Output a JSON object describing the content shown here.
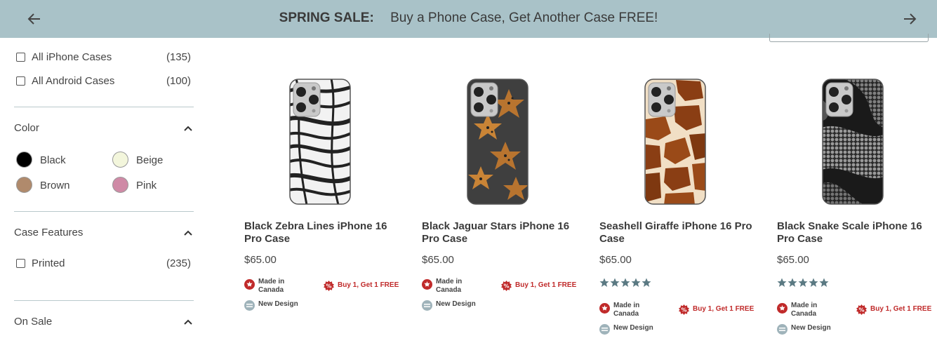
{
  "banner": {
    "strong": "SPRING SALE:",
    "message": "Buy a Phone Case, Get Another Case FREE!"
  },
  "filters": {
    "categories": [
      {
        "label": "All iPhone Cases",
        "count": "(135)"
      },
      {
        "label": "All Android Cases",
        "count": "(100)"
      }
    ],
    "color": {
      "title": "Color",
      "options": [
        {
          "label": "Black",
          "swatch": "#000000"
        },
        {
          "label": "Beige",
          "swatch": "#f3f6dc"
        },
        {
          "label": "Brown",
          "swatch": "#b08a6c"
        },
        {
          "label": "Pink",
          "swatch": "#cf8aa6"
        }
      ]
    },
    "case_features": {
      "title": "Case Features",
      "options": [
        {
          "label": "Printed",
          "count": "(235)"
        }
      ]
    },
    "on_sale": {
      "title": "On Sale"
    }
  },
  "products": [
    {
      "title_line1": "Black Zebra Lines iPhone 16",
      "title_line2": "Pro Case",
      "price": "$65.00",
      "rating_stars": 0,
      "pattern": "zebra"
    },
    {
      "title_line1": "Black Jaguar Stars iPhone 16",
      "title_line2": "Pro Case",
      "price": "$65.00",
      "rating_stars": 0,
      "pattern": "jaguar"
    },
    {
      "title_line1": "Seashell Giraffe iPhone 16 Pro",
      "title_line2": "Case",
      "price": "$65.00",
      "rating_stars": 5,
      "pattern": "giraffe"
    },
    {
      "title_line1": "Black Snake Scale iPhone 16",
      "title_line2": "Pro Case",
      "price": "$65.00",
      "rating_stars": 5,
      "pattern": "snake"
    }
  ],
  "badges": {
    "made_in_line1": "Made in",
    "made_in_line2": "Canada",
    "bogo": "Buy 1, Get 1 FREE",
    "new_design": "New Design"
  },
  "colors": {
    "banner_bg": "#a9c2c8",
    "star": "#5b7a83",
    "badge_red": "#c02a2a"
  }
}
